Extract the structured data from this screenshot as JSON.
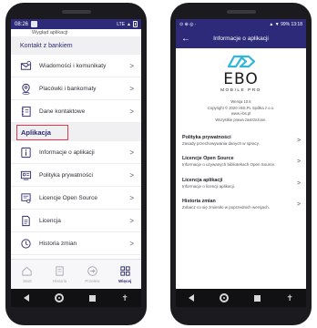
{
  "phone1": {
    "status": {
      "time": "08:26",
      "network": "LTE"
    },
    "partial_item": "Wygląd aplikacji",
    "sections": [
      {
        "title": "Kontakt z bankiem",
        "items": [
          {
            "label": "Wiadomości i komunikaty",
            "icon": "envelope-icon"
          },
          {
            "label": "Placówki i bankomaty",
            "icon": "location-pin-icon"
          },
          {
            "label": "Dane kontaktowe",
            "icon": "contact-book-icon"
          }
        ]
      },
      {
        "title": "Aplikacja",
        "items": [
          {
            "label": "Informacje o aplikacji",
            "icon": "info-icon"
          },
          {
            "label": "Polityka prywatności",
            "icon": "privacy-icon"
          },
          {
            "label": "Licencje Open Source",
            "icon": "license-icon"
          },
          {
            "label": "Licencja",
            "icon": "document-icon"
          },
          {
            "label": "Historia zmian",
            "icon": "history-icon"
          }
        ]
      }
    ],
    "chevron": ">",
    "tabs": [
      {
        "label": "Start",
        "icon": "home-icon"
      },
      {
        "label": "Historia",
        "icon": "history-doc-icon"
      },
      {
        "label": "Przelew",
        "icon": "transfer-icon"
      },
      {
        "label": "Więcej",
        "icon": "grid-icon"
      }
    ],
    "accent": "#2d2a7a",
    "highlight": "#e23b4b"
  },
  "phone2": {
    "status": {
      "battery": "99%",
      "time": "13:18"
    },
    "title": "Informacje o aplikacji",
    "back": "←",
    "logo_name": "EBO",
    "logo_sub": "MOBILE PRO",
    "version": "Wersja 10.6",
    "copyright": "Copyright © 2020 i-BS.PL Spółka z o.o.",
    "website": "www.i-bs.pl",
    "rights": "Wszystkie prawa zastrzeżone.",
    "items": [
      {
        "title": "Polityka prywatności",
        "desc": "Zasady przechowywania danych w spracy."
      },
      {
        "title": "Licencje Open Source",
        "desc": "Informacje o używanych bibliotekach Open Source."
      },
      {
        "title": "Licencja aplikacji",
        "desc": "Informacje o licencji aplikacji."
      },
      {
        "title": "Historia zmian",
        "desc": "Zobacz co się zmieniło w poprzednich wersjach."
      }
    ],
    "chevron": ">",
    "logo_color": "#2fb6d8"
  }
}
